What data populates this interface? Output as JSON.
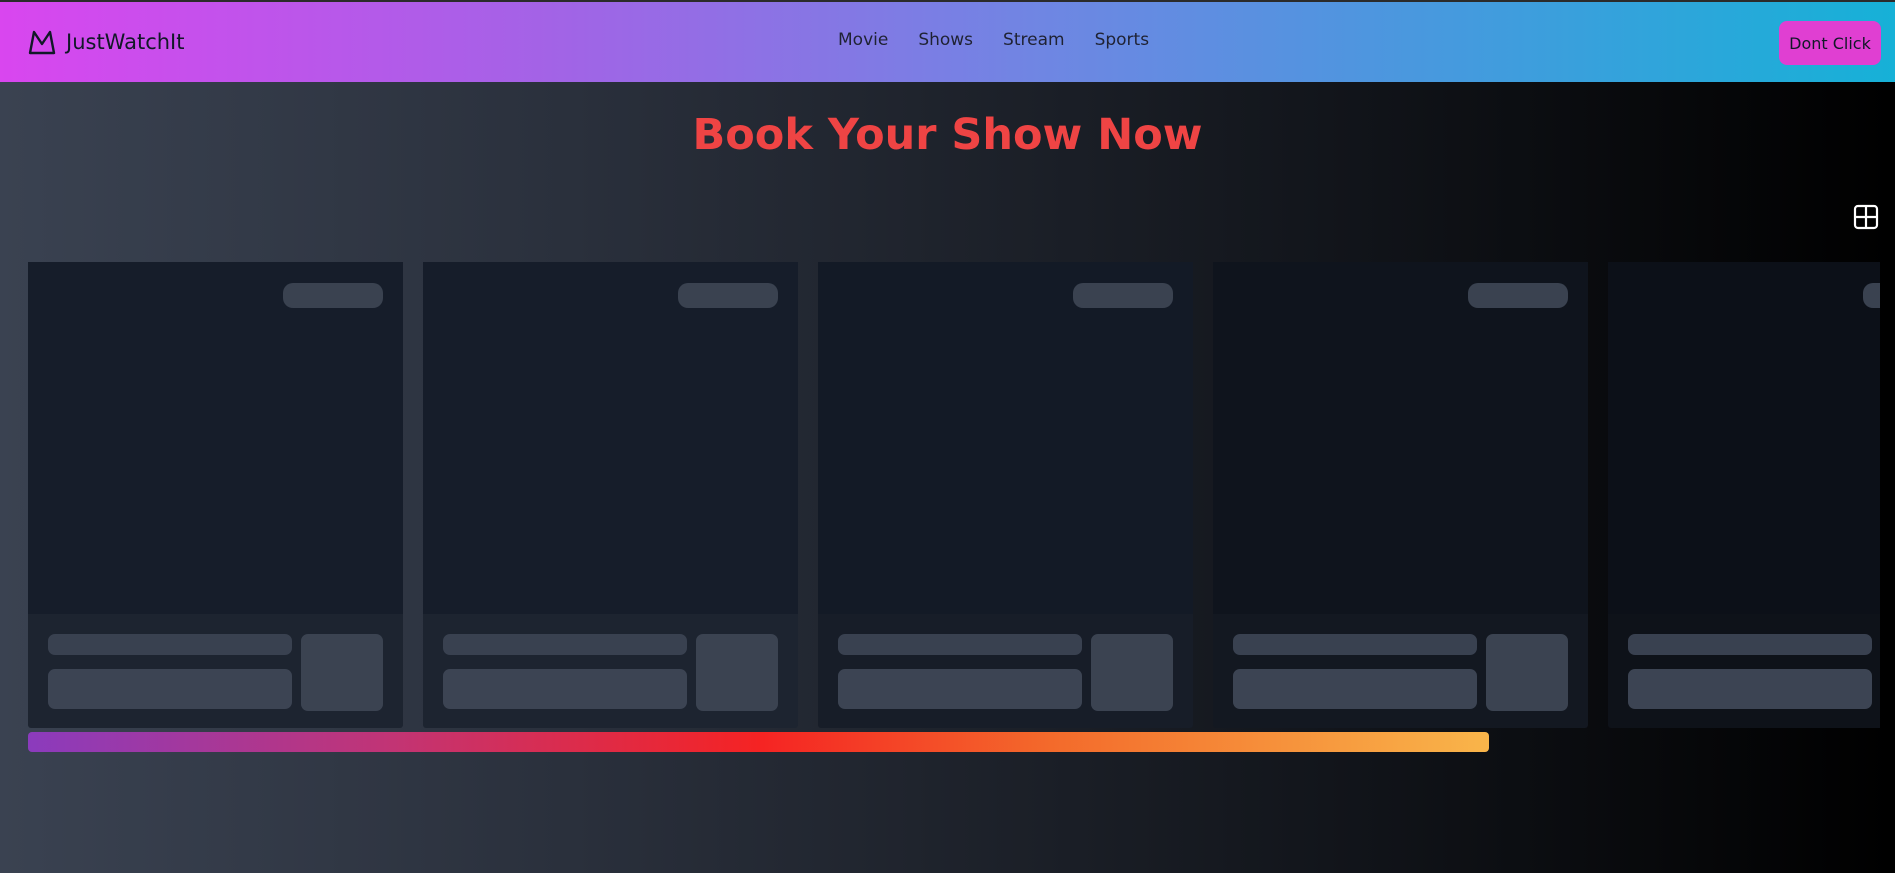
{
  "brand": {
    "name": "JustWatchIt",
    "logo_icon": "mountain-icon"
  },
  "nav": {
    "items": [
      {
        "label": "Movie"
      },
      {
        "label": "Shows"
      },
      {
        "label": "Stream"
      },
      {
        "label": "Sports"
      }
    ]
  },
  "header_button": {
    "label": "Dont Click"
  },
  "page": {
    "title": "Book Your Show Now"
  },
  "view_toggle": {
    "icon": "grid-view-icon"
  },
  "cards": {
    "state": "loading-skeleton",
    "visible_count": 5
  },
  "progress": {
    "fraction": 0.77,
    "colors": [
      "#8b3bbd",
      "#f52323",
      "#f9b54a"
    ]
  },
  "colors": {
    "accent_title": "#ef4444",
    "nav_gradient_start": "#d946ef",
    "nav_gradient_end": "#16b1d7",
    "button_bg": "#e03fd2"
  }
}
